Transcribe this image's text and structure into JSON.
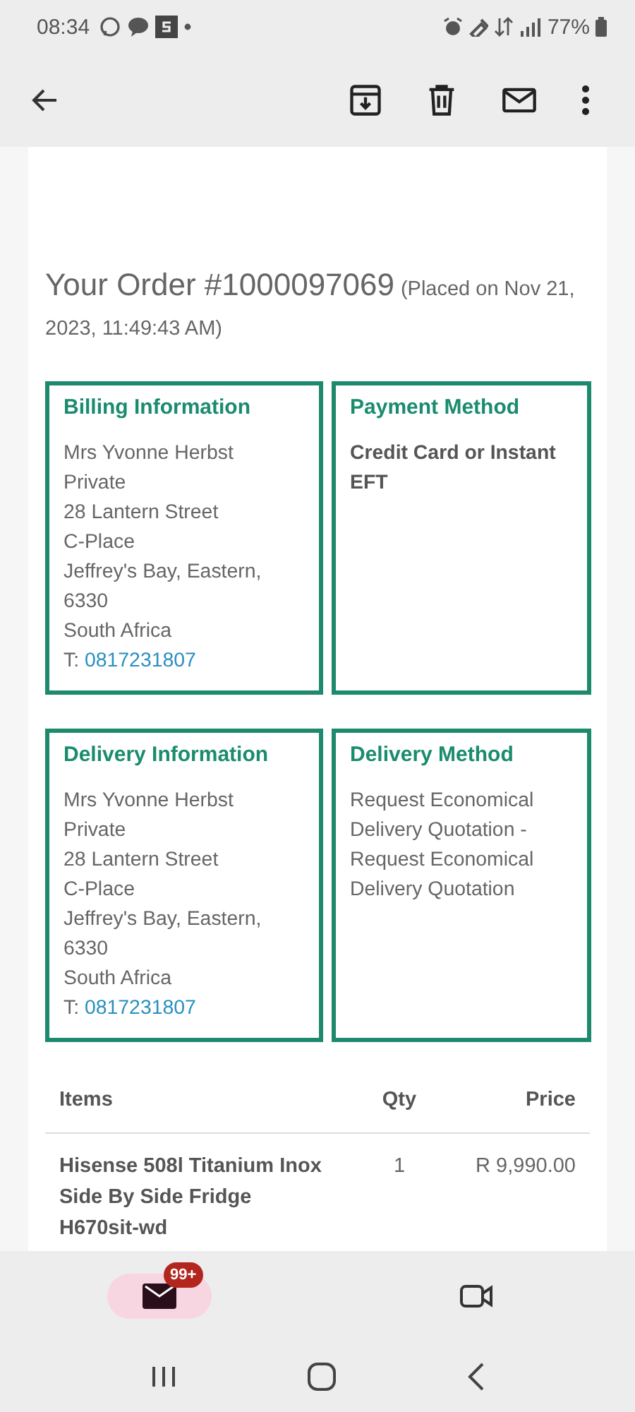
{
  "status_bar": {
    "time": "08:34",
    "battery": "77%"
  },
  "order": {
    "title": "Your Order #1000097069",
    "placed": "(Placed on Nov 21, 2023, 11:49:43 AM)"
  },
  "sections": [
    {
      "kind": "address",
      "title": "Billing Information",
      "lines": [
        "Mrs Yvonne Herbst",
        "Private",
        "28 Lantern Street",
        "C-Place",
        "Jeffrey's Bay, Eastern,",
        "6330",
        "South Africa"
      ],
      "phone_label": "T:",
      "phone": "0817231807"
    },
    {
      "kind": "method",
      "title": "Payment Method",
      "text": "Credit Card or Instant EFT",
      "strong": true
    },
    {
      "kind": "address",
      "title": "Delivery Information",
      "lines": [
        "Mrs Yvonne Herbst",
        "Private",
        "28 Lantern Street",
        "C-Place",
        "Jeffrey's Bay, Eastern,",
        "6330",
        "South Africa"
      ],
      "phone_label": "T:",
      "phone": "0817231807"
    },
    {
      "kind": "method",
      "title": "Delivery Method",
      "text": "Request Economical Delivery Quotation - Request Economical Delivery Quotation",
      "strong": false
    }
  ],
  "items_table": {
    "columns": [
      "Items",
      "Qty",
      "Price"
    ],
    "rows": [
      {
        "item": "Hisense 508l Titanium Inox Side By Side Fridge H670sit-wd",
        "qty": "1",
        "price": "R 9,990.00"
      }
    ]
  },
  "bottom_nav": [
    {
      "kind": "mail",
      "selected": true,
      "badge": "99+"
    },
    {
      "kind": "video",
      "selected": false
    }
  ]
}
